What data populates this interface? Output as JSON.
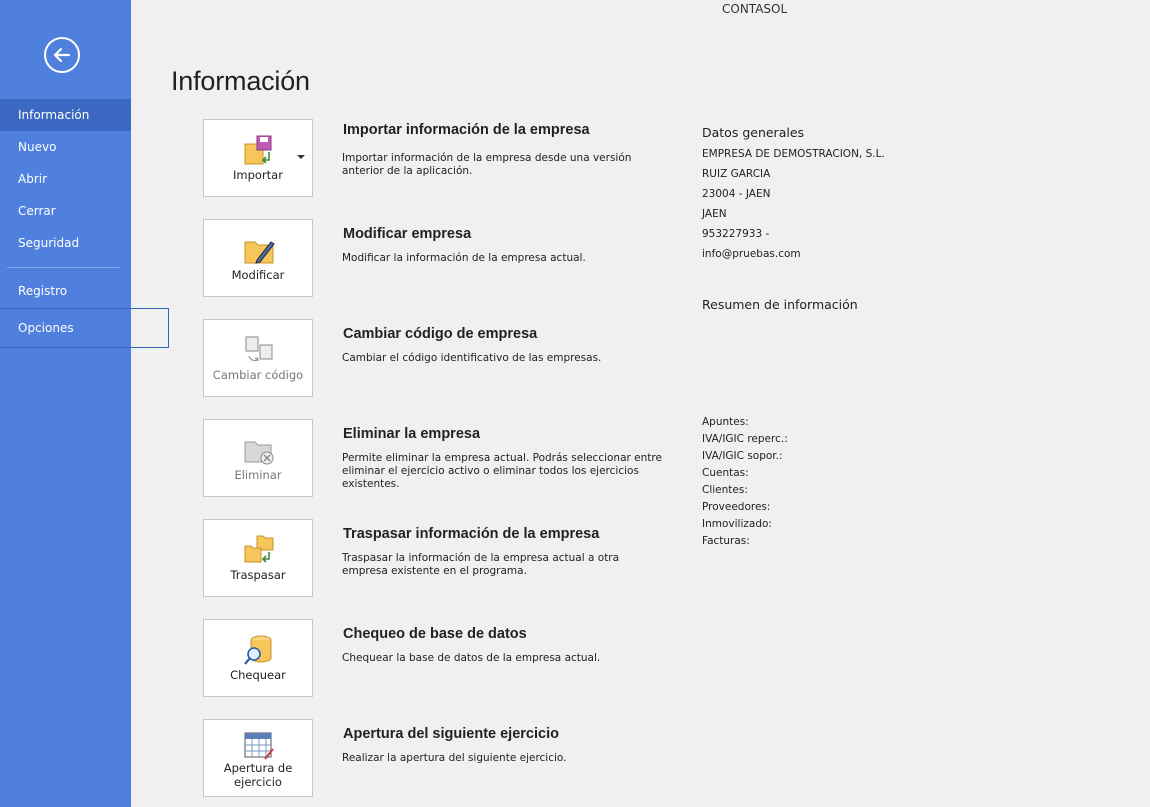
{
  "app": {
    "title": "CONTASOL"
  },
  "sidebar": {
    "back_icon": "arrow-left-icon",
    "items": [
      {
        "label": "Información"
      },
      {
        "label": "Nuevo"
      },
      {
        "label": "Abrir"
      },
      {
        "label": "Cerrar"
      },
      {
        "label": "Seguridad"
      },
      {
        "label": "Registro"
      },
      {
        "label": "Opciones"
      }
    ],
    "active": "Información"
  },
  "page": {
    "title": "Información"
  },
  "actions": [
    {
      "button": "Importar",
      "title": "Importar información de la empresa",
      "desc": "Importar información de la empresa desde una versión anterior de la aplicación."
    },
    {
      "button": "Modificar",
      "title": "Modificar empresa",
      "desc": "Modificar la información de la empresa actual."
    },
    {
      "button": "Cambiar código",
      "title": "Cambiar código de empresa",
      "desc": "Cambiar el código identificativo de las empresas."
    },
    {
      "button": "Eliminar",
      "title": "Eliminar la empresa",
      "desc": "Permite eliminar la empresa actual. Podrás seleccionar entre eliminar el ejercicio activo o eliminar todos los ejercicios existentes."
    },
    {
      "button": "Traspasar",
      "title": "Traspasar información de la empresa",
      "desc": "Traspasar la información de la empresa actual a otra empresa existente en el programa."
    },
    {
      "button": "Chequear",
      "title": "Chequeo de base de datos",
      "desc": "Chequear la base de datos de la empresa actual."
    },
    {
      "button": "Apertura de ejercicio",
      "title": "Apertura del siguiente ejercicio",
      "desc": "Realizar la apertura del siguiente ejercicio."
    }
  ],
  "info": {
    "general_heading": "Datos generales",
    "general": [
      "EMPRESA DE DEMOSTRACION, S.L.",
      "RUIZ GARCIA",
      "23004 - JAEN",
      "JAEN",
      "953227933 -",
      "info@pruebas.com"
    ],
    "summary_heading": "Resumen de información",
    "summary": [
      "Apuntes:",
      "IVA/IGIC reperc.:",
      "IVA/IGIC sopor.:",
      "Cuentas:",
      "Clientes:",
      "Proveedores:",
      "Inmovilizado:",
      "Facturas:"
    ]
  },
  "colors": {
    "sidebar": "#4f80de",
    "sidebar_active": "#3b68c0",
    "background": "#f0f0f0"
  }
}
